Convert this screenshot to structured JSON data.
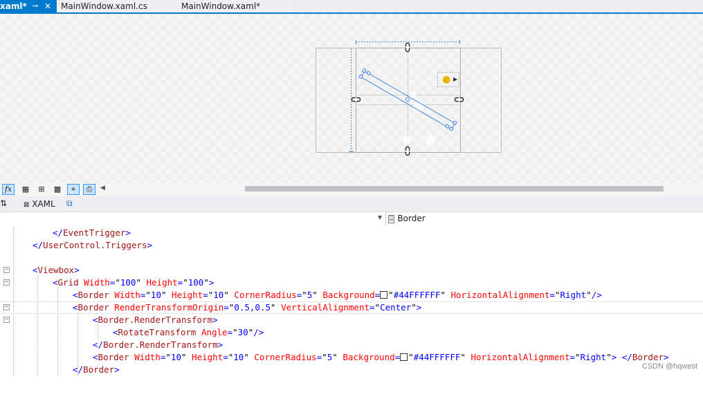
{
  "tabs": [
    {
      "label": "xaml*",
      "pin_icon": "pin-icon",
      "close_icon": "close-icon",
      "active": true
    },
    {
      "label": "MainWindow.xaml.cs",
      "active": false
    },
    {
      "label": "MainWindow.xaml*",
      "active": false
    }
  ],
  "colors": {
    "accent": "#007acc",
    "selection": "#4a86d8",
    "tag": "#a31515",
    "attribute": "#ff0000",
    "value": "#0000ff"
  },
  "designer": {
    "quick_action_icon": "lightbulb-icon",
    "quick_action_arrow": "▶"
  },
  "toolbar": {
    "buttons": [
      {
        "label": "fx",
        "icon": "fx-icon",
        "selected": true
      },
      {
        "label": "▦",
        "icon": "grid-icon",
        "selected": false
      },
      {
        "label": "⊞",
        "icon": "snap-gridlines-icon",
        "selected": false
      },
      {
        "label": "▩",
        "icon": "checkerboard-icon",
        "selected": false
      },
      {
        "label": "⌖",
        "icon": "snap-snaplines-icon",
        "selected": true
      },
      {
        "label": "⎙",
        "icon": "project-code-icon",
        "selected": true
      }
    ],
    "collapse_arrow": "◀"
  },
  "split": {
    "swap_label": "⇅",
    "xaml_tab": "XAML",
    "xaml_icon": "⊠",
    "popout_icon": "⧉"
  },
  "nav": {
    "left_value": "",
    "dropdown_arrow": "▼",
    "right_icon": "⌸",
    "right_value": "Border"
  },
  "code_lines": [
    "</EventTrigger>",
    "</UserControl.Triggers>",
    "",
    "<Viewbox>",
    "<Grid Width=\"100\" Height=\"100\">",
    "<Border Width=\"10\" Height=\"10\" CornerRadius=\"5\" Background=\"#44FFFFFF\" HorizontalAlignment=\"Right\"/>",
    "<Border RenderTransformOrigin=\"0.5,0.5\" VerticalAlignment=\"Center\">",
    "<Border.RenderTransform>",
    "<RotateTransform Angle=\"30\"/>",
    "</Border.RenderTransform>",
    "<Border Width=\"10\" Height=\"10\" CornerRadius=\"5\" Background=\"#44FFFFFF\" HorizontalAlignment=\"Right\"> </Border>",
    "</Border>"
  ],
  "watermark": "CSDN @hqwest"
}
